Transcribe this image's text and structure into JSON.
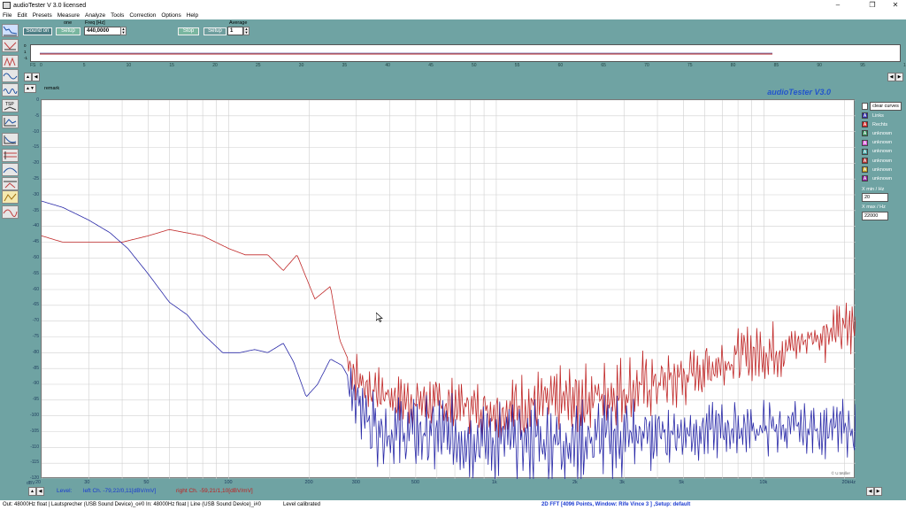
{
  "window": {
    "title": "audioTester  V 3.0   licensed",
    "min": "–",
    "max": "❐",
    "close": "✕"
  },
  "menu": [
    "File",
    "Edit",
    "Presets",
    "Measure",
    "Analyze",
    "Tools",
    "Correction",
    "Options",
    "Help"
  ],
  "toolbar": {
    "sound_on": "Sound on",
    "setup1": "Setup",
    "one_label": "one",
    "freq_label": "Freq [Hz]",
    "freq_value": "440,0000",
    "stop": "Stop",
    "setup2": "Setup",
    "average_label": "Average",
    "average_value": "1"
  },
  "time_panel": {
    "ticks": [
      "0",
      "1",
      "-1"
    ],
    "axis": [
      "FS",
      "0",
      "5",
      "10",
      "15",
      "20",
      "25",
      "30",
      "35",
      "40",
      "45",
      "50",
      "55",
      "60",
      "65",
      "70",
      "75",
      "80",
      "85",
      "90",
      "95",
      "100ms"
    ]
  },
  "remark": "remark",
  "brand": "audioTester  V3.0",
  "copyright": "© U.Müller",
  "plot": {
    "y_labels": [
      "0",
      "-5",
      "-10",
      "-15",
      "-20",
      "-25",
      "-30",
      "-35",
      "-40",
      "-45",
      "-50",
      "-55",
      "-60",
      "-65",
      "-70",
      "-75",
      "-80",
      "-85",
      "-90",
      "-95",
      "-100",
      "-105",
      "-110",
      "-115",
      "-120"
    ],
    "y_unit": "dBV",
    "x_labels": [
      "20",
      "30",
      "50",
      "100",
      "200",
      "300",
      "500",
      "1k",
      "2k",
      "3k",
      "5k",
      "10k",
      "20kHz"
    ]
  },
  "legend": {
    "clear": "clear curves",
    "items": [
      {
        "letter": "A",
        "name": "Links",
        "color": "#2a2aa8"
      },
      {
        "letter": "A",
        "name": "Rechts",
        "color": "#d02020"
      },
      {
        "letter": "A",
        "name": "unknown",
        "color": "#2e8b57"
      },
      {
        "letter": "A",
        "name": "unknown",
        "color": "#d050d0"
      },
      {
        "letter": "A",
        "name": "unknown",
        "color": "#3a9a9a"
      },
      {
        "letter": "A",
        "name": "unknown",
        "color": "#b03030"
      },
      {
        "letter": "A",
        "name": "unknown",
        "color": "#c0a020"
      },
      {
        "letter": "A",
        "name": "unknown",
        "color": "#9020a0"
      }
    ],
    "xmin_label": "X min / Hz",
    "xmin_value": "20",
    "xmax_label": "X max / Hz",
    "xmax_value": "22000"
  },
  "level": {
    "label": "Level:",
    "left": "left Ch. -79,22/0,11[dBV/mV]",
    "right": "right Ch. -59,21/1,10[dBV/mV]"
  },
  "status": {
    "out": "Out: 48000Hz float  | Lautsprecher (USB Sound Device)_o#0  In: 48000Hz float  | Line (USB Sound Device)_i#0",
    "calib": "Level calibrated",
    "fft": "2D FFT [4096 Points, Window: Rife Vince 3 ]  ,Setup:  default"
  },
  "colors": {
    "bg": "#6fa3a3",
    "left": "#2a2aa8",
    "right": "#c02828"
  }
}
